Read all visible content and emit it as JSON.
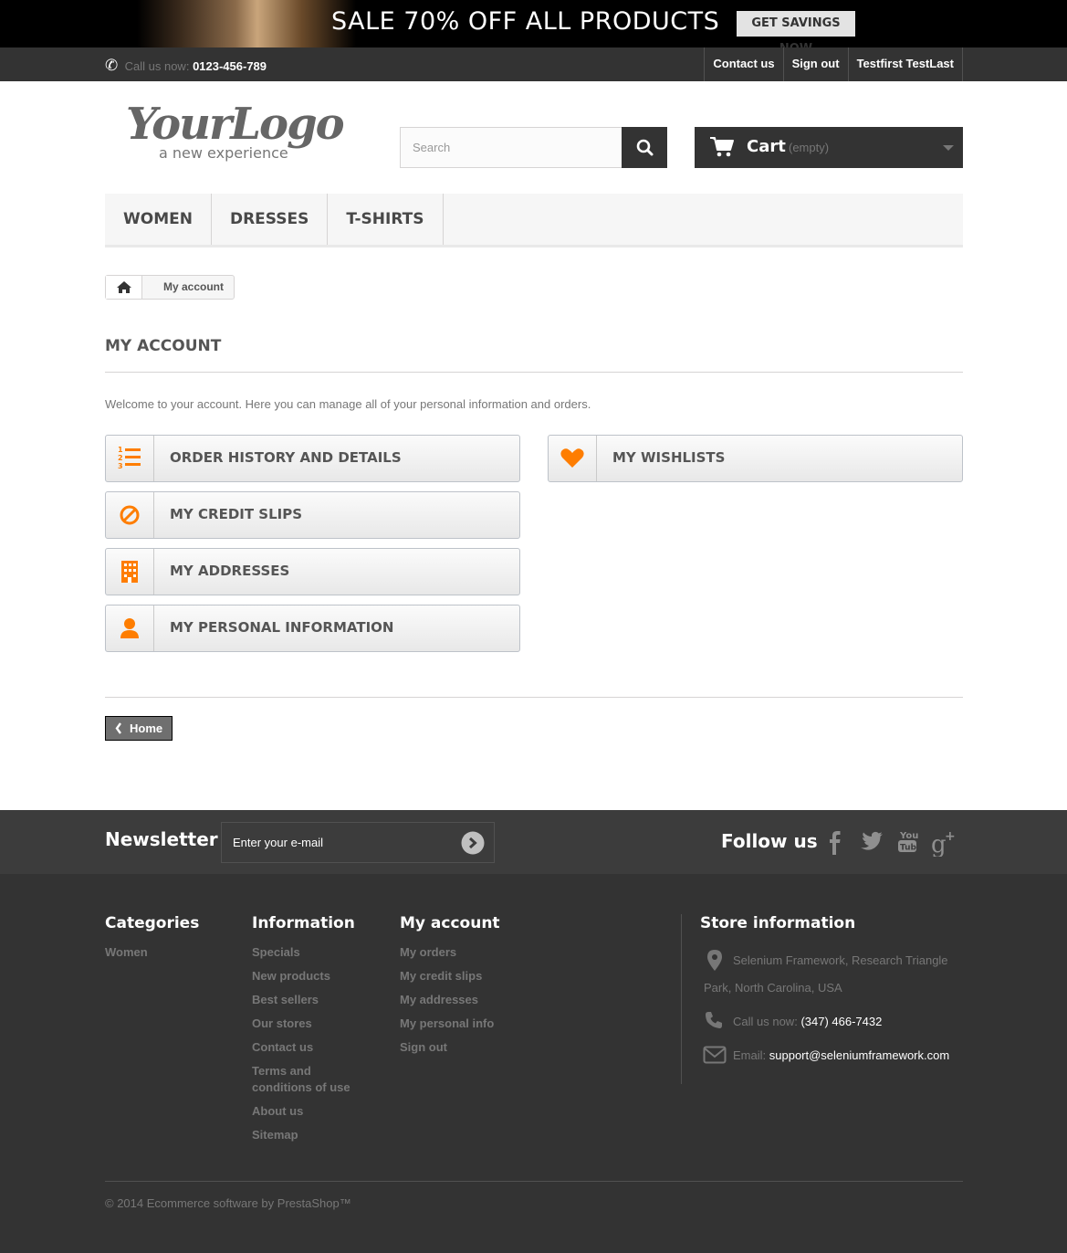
{
  "banner": {
    "headline": "SALE 70% OFF ALL PRODUCTS",
    "cta": "GET SAVINGS NOW"
  },
  "topnav": {
    "call_label": "Call us now:",
    "phone": "0123-456-789",
    "links": [
      "Contact us",
      "Sign out",
      "Testfirst TestLast"
    ]
  },
  "logo": {
    "text": "YourLogo",
    "tagline": "a new experience"
  },
  "search": {
    "placeholder": "Search"
  },
  "cart": {
    "label": "Cart",
    "status": "(empty)"
  },
  "menu": [
    "WOMEN",
    "DRESSES",
    "T-SHIRTS"
  ],
  "breadcrumb": {
    "current": "My account"
  },
  "page": {
    "title": "MY ACCOUNT",
    "welcome": "Welcome to your account. Here you can manage all of your personal information and orders."
  },
  "account_links": {
    "order_history": "ORDER HISTORY AND DETAILS",
    "credit_slips": "MY CREDIT SLIPS",
    "addresses": "MY ADDRESSES",
    "personal_info": "MY PERSONAL INFORMATION",
    "wishlists": "MY WISHLISTS"
  },
  "home_button": "Home",
  "newsletter": {
    "heading": "Newsletter",
    "placeholder": "Enter your e-mail"
  },
  "follow": {
    "heading": "Follow us",
    "icons": [
      "facebook-icon",
      "twitter-icon",
      "youtube-icon",
      "google-plus-icon"
    ]
  },
  "footer": {
    "categories": {
      "heading": "Categories",
      "items": [
        "Women"
      ]
    },
    "information": {
      "heading": "Information",
      "items": [
        "Specials",
        "New products",
        "Best sellers",
        "Our stores",
        "Contact us",
        "Terms and conditions of use",
        "About us",
        "Sitemap"
      ]
    },
    "my_account": {
      "heading": "My account",
      "items": [
        "My orders",
        "My credit slips",
        "My addresses",
        "My personal info",
        "Sign out"
      ]
    },
    "store": {
      "heading": "Store information",
      "address_line1": "Selenium Framework, Research Triangle",
      "address_line2": "Park, North Carolina, USA",
      "call_label": "Call us now:",
      "phone": "(347) 466-7432",
      "email_label": "Email:",
      "email": "support@seleniumframework.com"
    },
    "copyright": "© 2014 Ecommerce software by PrestaShop™"
  },
  "colors": {
    "accent": "#f13340",
    "icon_orange": "#fe7d00",
    "dark": "#333333"
  }
}
